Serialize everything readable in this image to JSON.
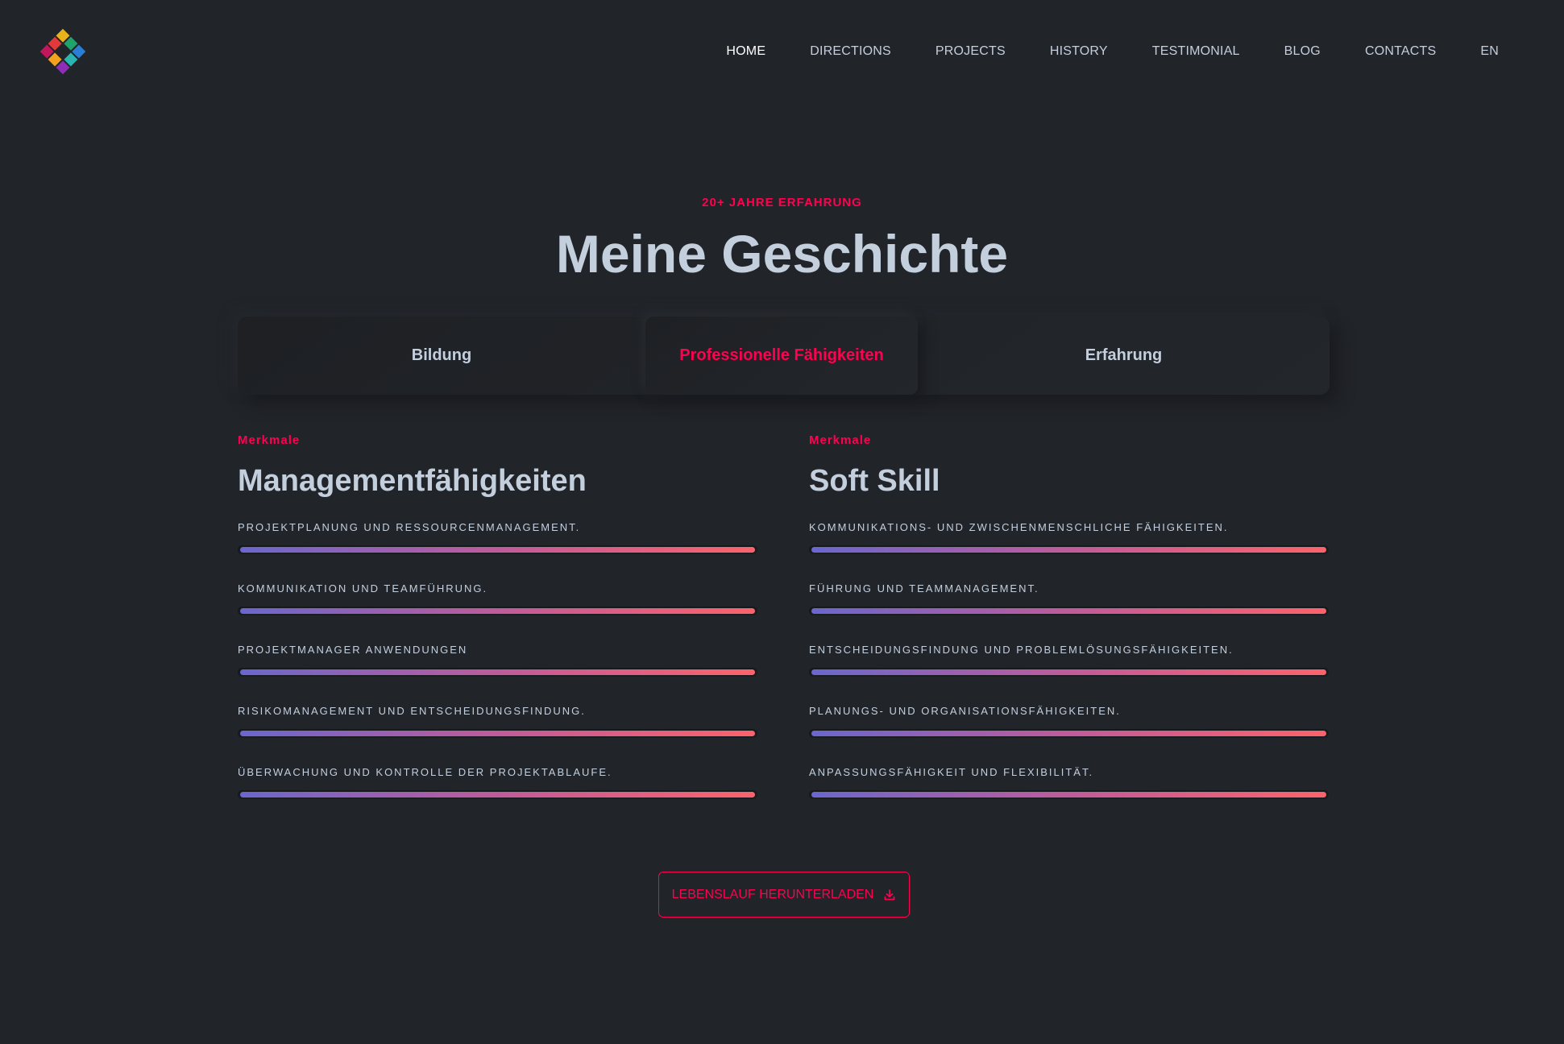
{
  "nav": {
    "items": [
      {
        "label": "HOME",
        "active": true
      },
      {
        "label": "DIRECTIONS",
        "active": false
      },
      {
        "label": "PROJECTS",
        "active": false
      },
      {
        "label": "HISTORY",
        "active": false
      },
      {
        "label": "TESTIMONIAL",
        "active": false
      },
      {
        "label": "BLOG",
        "active": false
      },
      {
        "label": "CONTACTS",
        "active": false
      },
      {
        "label": "EN",
        "active": false
      }
    ]
  },
  "hero": {
    "eyebrow": "20+ JAHRE ERFAHRUNG",
    "title": "Meine Geschichte"
  },
  "tabs": [
    {
      "label": "Bildung",
      "active": false
    },
    {
      "label": "Professionelle Fähigkeiten",
      "active": true
    },
    {
      "label": "Erfahrung",
      "active": false
    }
  ],
  "columns": {
    "left": {
      "subtitle": "Merkmale",
      "title": "Managementfähigkeiten",
      "skills": [
        {
          "label": "PROJEKTPLANUNG UND RESSOURCENMANAGEMENT.",
          "percent": 100
        },
        {
          "label": "KOMMUNIKATION UND TEAMFÜHRUNG.",
          "percent": 100
        },
        {
          "label": "PROJEKTMANAGER ANWENDUNGEN",
          "percent": 100
        },
        {
          "label": "RISIKOMANAGEMENT UND ENTSCHEIDUNGSFINDUNG.",
          "percent": 100
        },
        {
          "label": "ÜBERWACHUNG UND KONTROLLE DER PROJEKTABLAUFE.",
          "percent": 100
        }
      ]
    },
    "right": {
      "subtitle": "Merkmale",
      "title": "Soft Skill",
      "skills": [
        {
          "label": "KOMMUNIKATIONS- UND ZWISCHENMENSCHLICHE FÄHIGKEITEN.",
          "percent": 100
        },
        {
          "label": "FÜHRUNG UND TEAMMANAGEMENT.",
          "percent": 100
        },
        {
          "label": "ENTSCHEIDUNGSFINDUNG UND PROBLEMLÖSUNGSFÄHIGKEITEN.",
          "percent": 100
        },
        {
          "label": "PLANUNGS- UND ORGANISATIONSFÄHIGKEITEN.",
          "percent": 100
        },
        {
          "label": "ANPASSUNGSFÄHIGKEIT UND FLEXIBILITÄT.",
          "percent": 100
        }
      ]
    }
  },
  "cta": {
    "label": "LEBENSLAUF HERUNTERLADEN",
    "icon": "download-icon"
  },
  "colors": {
    "background": "#212429",
    "accent": "#ff014f",
    "text": "#c4cfde",
    "bar_gradient_start": "#6a67ce",
    "bar_gradient_end": "#fc636b"
  }
}
